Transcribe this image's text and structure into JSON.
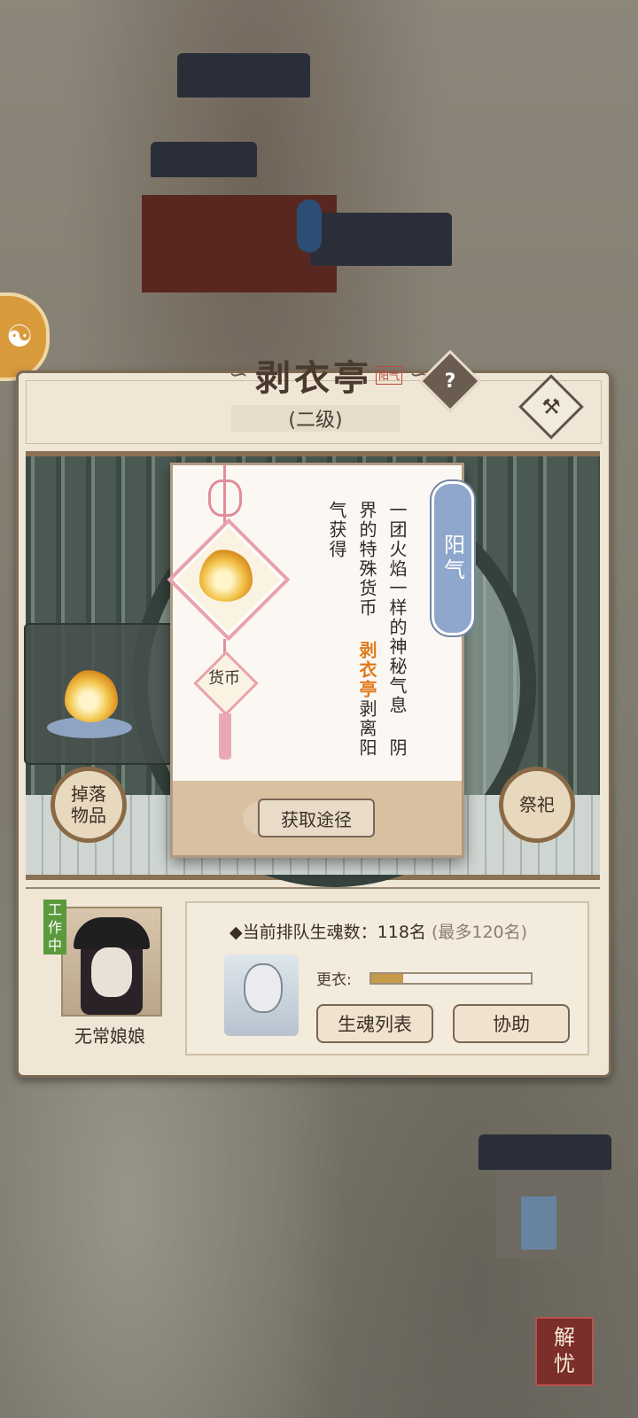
{
  "building": {
    "name": "剥衣亭",
    "seal": "阳气",
    "level": "(二级)",
    "help_label": "?",
    "build_icon": "hammer-icon"
  },
  "side_buttons": {
    "drop": "掉落\n物品",
    "sacrifice": "祭祀"
  },
  "worker": {
    "status": "工作中",
    "name": "无常娘娘"
  },
  "queue": {
    "label": "当前排队生魂数：",
    "count": "118名",
    "max": "(最多120名)",
    "bullet": "◆"
  },
  "progress": {
    "label": "更衣:",
    "value": 0.2
  },
  "actions": {
    "soul_list": "生魂列表",
    "assist": "协助"
  },
  "popup": {
    "item_name": "阳气",
    "category": "货币",
    "desc_line1": "一团火焰一样的神秘气息",
    "desc_line2": "阴界的特殊货币",
    "desc_line3_highlight": "剥衣亭",
    "desc_line3_rest": "剥离阳气获得",
    "get_button": "获取途径"
  },
  "corner_stamp": "解忧",
  "colors": {
    "accent_orange": "#e07a1b",
    "tag_blue": "#8fa7cc",
    "working_green": "#5a9a3c"
  }
}
